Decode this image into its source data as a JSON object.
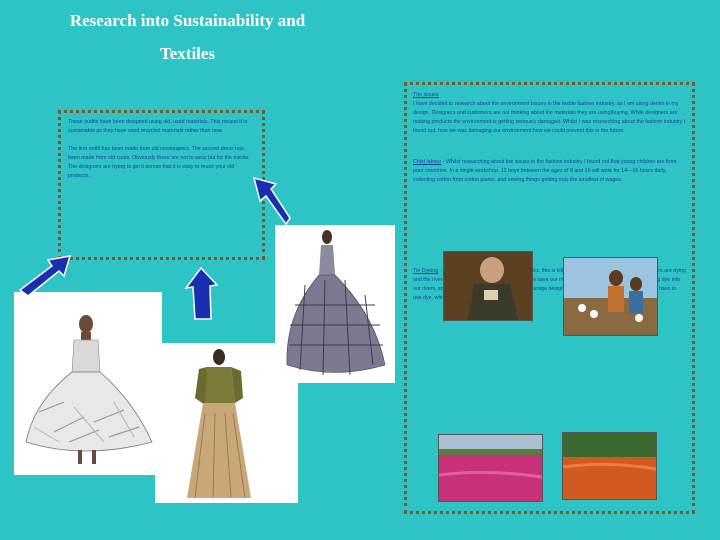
{
  "title": {
    "line1": "Research into Sustainability and",
    "line2": "Textiles"
  },
  "left_box": {
    "para1": "These outfits have been designed using old, used materials. This means it is sustainable as they have used recycled materials rather than new.",
    "para2": "The first outfit has been made from old newspapers. The second dress has been made from old coats. Obviously these are not to wear but for the media. The designers are trying to get it across that it is easy to reuse your old products."
  },
  "right_box": {
    "issues_heading": "The issues",
    "issues_text": "I have decided to research about the environment issues in the textile fashion industry, as I am using denim in my design. Designers and customers are not thinking about the materials they are using/buying. While designers are making products the environment is getting seriously damaged. Whilst I was researching about the fashion industry I found out, how we was damaging our environment how we could prevent this in the future.",
    "child_heading": "Child labour",
    "child_text": " - Whilst researching about the issues in the fashion industry I found out that young children are from poor countries. In a single workshop, 12 boys between the ages of 8 and 16 will work for 14—16 hours daily, collecting cotton from cotton plants, and sewing things getting only the smallest of wages.",
    "dye_heading": "Tie Dyeing",
    "dye_text": " - Factories are dumping the dye into rivers, this is killing wildlife and rivers. The fish in the rivers are dying and the rivers are being polluted. If we want going to save our rivers and wildlife we need to stop dumping dye into our rivers, so if we recycle our old clothes and encourage designers to use recycled materials we will not have to use dye, which end up in our rivers."
  },
  "colors": {
    "background": "#2ec4c6",
    "text_blue": "#1a3fa0",
    "arrow_blue": "#1a2fb0",
    "border_brown": "#7a5a2a"
  }
}
